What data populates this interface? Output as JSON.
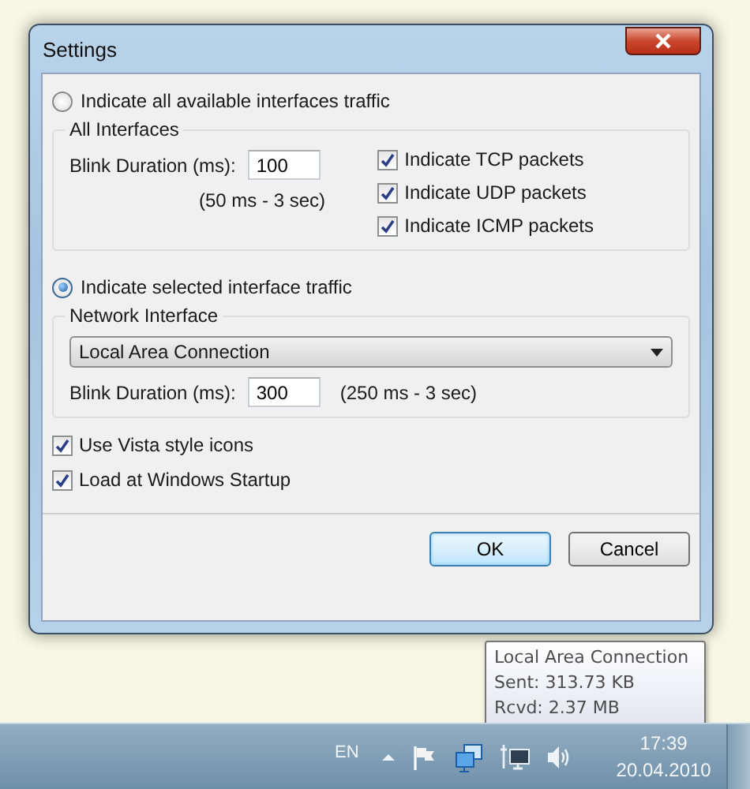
{
  "window": {
    "title": "Settings"
  },
  "modes": [
    {
      "label": "Indicate all available interfaces traffic",
      "selected": false
    },
    {
      "label": "Indicate selected interface traffic",
      "selected": true
    }
  ],
  "all_interfaces": {
    "title": "All Interfaces",
    "blink_label": "Blink Duration (ms):",
    "blink_value": "100",
    "range": "(50 ms - 3 sec)",
    "packets": [
      {
        "label": "Indicate TCP packets",
        "checked": true
      },
      {
        "label": "Indicate UDP packets",
        "checked": true
      },
      {
        "label": "Indicate ICMP packets",
        "checked": true
      }
    ]
  },
  "network_interface": {
    "title": "Network Interface",
    "dropdown": "Local Area Connection",
    "blink_label": "Blink Duration (ms):",
    "blink_value": "300",
    "range": "(250 ms - 3 sec)"
  },
  "options": [
    {
      "label": "Use Vista style icons",
      "checked": true
    },
    {
      "label": "Load at Windows Startup",
      "checked": true
    }
  ],
  "buttons": [
    {
      "label": "OK",
      "default": true
    },
    {
      "label": "Cancel",
      "default": false
    }
  ],
  "tooltip": {
    "lines": [
      "Local Area Connection",
      "Sent: 313.73 KB",
      "Rcvd: 2.37 MB"
    ]
  },
  "taskbar": {
    "language": "EN",
    "time": "17:39",
    "date": "20.04.2010"
  }
}
